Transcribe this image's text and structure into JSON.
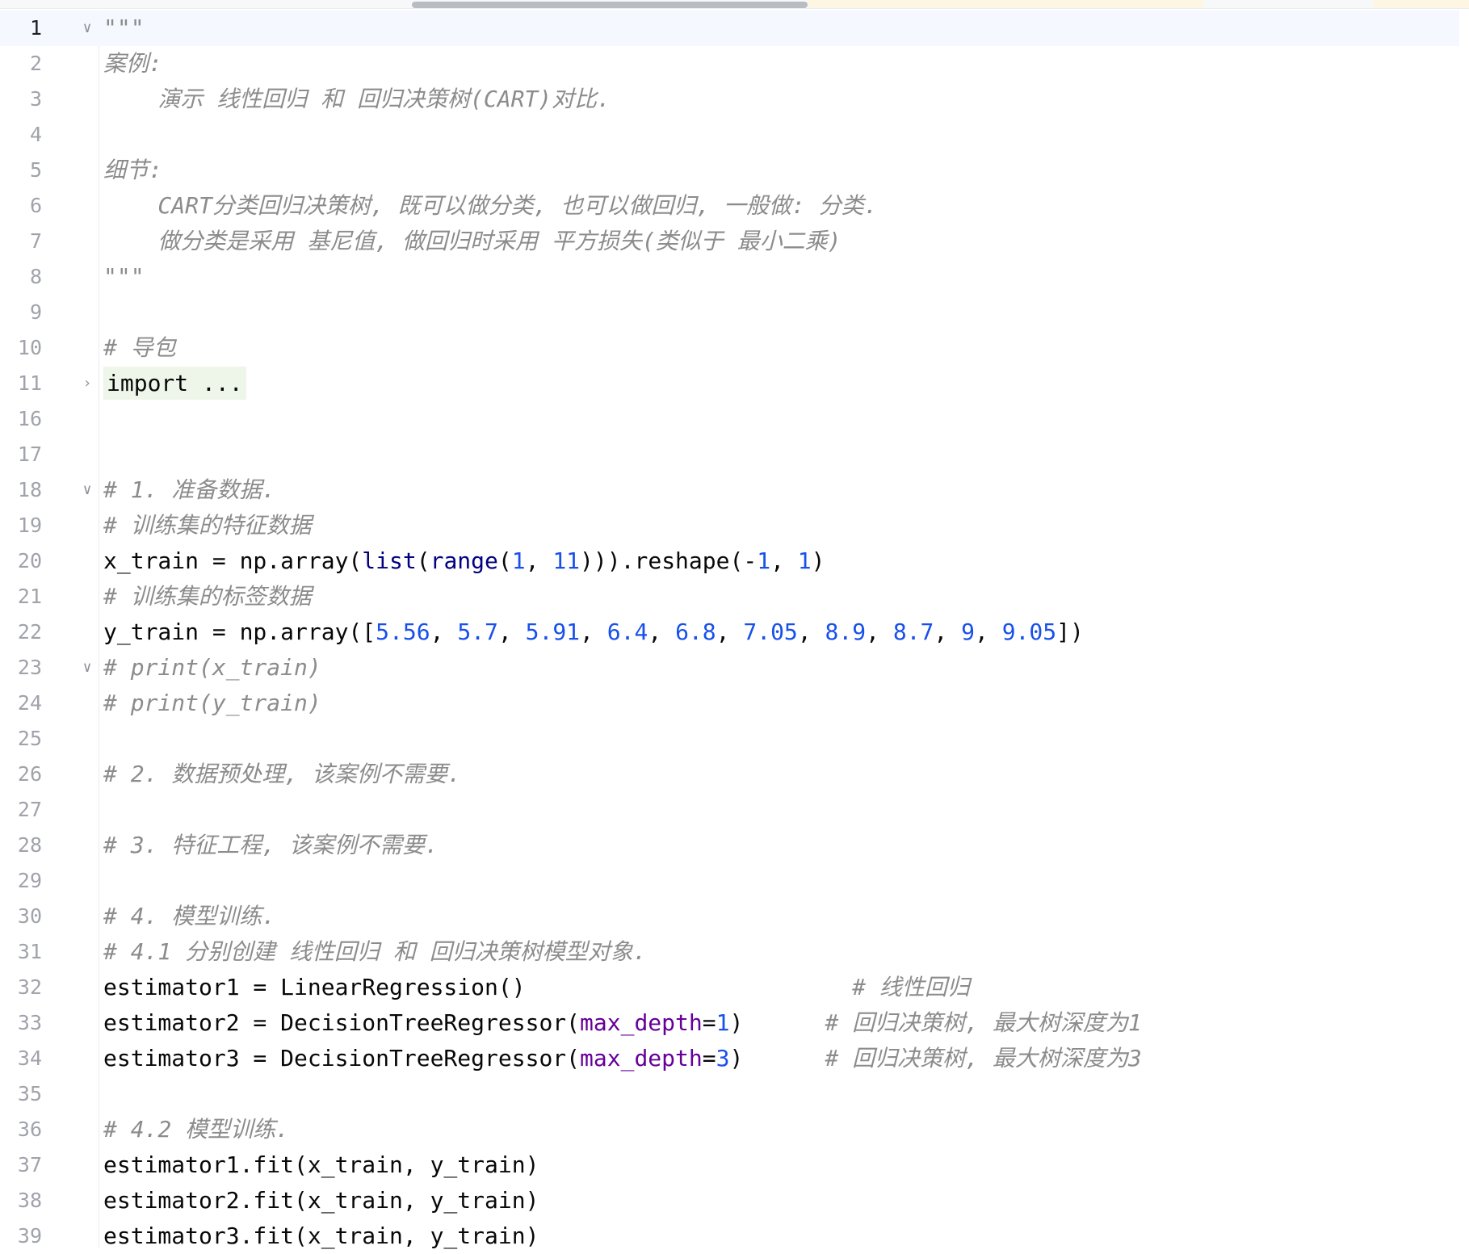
{
  "editor": {
    "colors": {
      "background": "#ffffff",
      "current_line": "#f5f8fe",
      "line_number": "#a1a3ab",
      "comment": "#8c8c8c",
      "number": "#1750eb",
      "keyword_arg": "#660099",
      "fold_highlight": "#edf6e9"
    },
    "lines": [
      {
        "n": "1",
        "fold": "chevron-down",
        "current": true,
        "tokens": [
          {
            "t": "\"\"\"",
            "c": "doc"
          }
        ]
      },
      {
        "n": "2",
        "tokens": [
          {
            "t": "案例:",
            "c": "doc"
          }
        ]
      },
      {
        "n": "3",
        "tokens": [
          {
            "t": "    演示 线性回归 和 回归决策树(CART)对比.",
            "c": "doc"
          }
        ]
      },
      {
        "n": "4",
        "tokens": []
      },
      {
        "n": "5",
        "tokens": [
          {
            "t": "细节:",
            "c": "doc"
          }
        ]
      },
      {
        "n": "6",
        "tokens": [
          {
            "t": "    CART分类回归决策树, 既可以做分类, 也可以做回归, 一般做: 分类.",
            "c": "doc"
          }
        ]
      },
      {
        "n": "7",
        "tokens": [
          {
            "t": "    做分类是采用 基尼值, 做回归时采用 平方损失(类似于 最小二乘)",
            "c": "doc"
          }
        ]
      },
      {
        "n": "8",
        "tokens": [
          {
            "t": "\"\"\"",
            "c": "doc"
          }
        ]
      },
      {
        "n": "9",
        "tokens": []
      },
      {
        "n": "10",
        "tokens": [
          {
            "t": "# 导包",
            "c": "comment"
          }
        ]
      },
      {
        "n": "11",
        "fold": "chevron-right",
        "tokens": [
          {
            "t": "import ...",
            "c": "fold"
          }
        ]
      },
      {
        "n": "16",
        "tokens": []
      },
      {
        "n": "17",
        "tokens": []
      },
      {
        "n": "18",
        "fold": "chevron-down",
        "tokens": [
          {
            "t": "# 1. 准备数据.",
            "c": "comment"
          }
        ]
      },
      {
        "n": "19",
        "tokens": [
          {
            "t": "# 训练集的特征数据",
            "c": "comment"
          }
        ]
      },
      {
        "n": "20",
        "tokens": [
          {
            "t": "x_train = np.array("
          },
          {
            "t": "list",
            "c": "builtin"
          },
          {
            "t": "("
          },
          {
            "t": "range",
            "c": "builtin"
          },
          {
            "t": "("
          },
          {
            "t": "1",
            "c": "num"
          },
          {
            "t": ", "
          },
          {
            "t": "11",
            "c": "num"
          },
          {
            "t": "))).reshape(-"
          },
          {
            "t": "1",
            "c": "num"
          },
          {
            "t": ", "
          },
          {
            "t": "1",
            "c": "num"
          },
          {
            "t": ")"
          }
        ]
      },
      {
        "n": "21",
        "tokens": [
          {
            "t": "# 训练集的标签数据",
            "c": "comment"
          }
        ]
      },
      {
        "n": "22",
        "tokens": [
          {
            "t": "y_train = np.array(["
          },
          {
            "t": "5.56",
            "c": "num"
          },
          {
            "t": ", "
          },
          {
            "t": "5.7",
            "c": "num"
          },
          {
            "t": ", "
          },
          {
            "t": "5.91",
            "c": "num"
          },
          {
            "t": ", "
          },
          {
            "t": "6.4",
            "c": "num"
          },
          {
            "t": ", "
          },
          {
            "t": "6.8",
            "c": "num"
          },
          {
            "t": ", "
          },
          {
            "t": "7.05",
            "c": "num"
          },
          {
            "t": ", "
          },
          {
            "t": "8.9",
            "c": "num"
          },
          {
            "t": ", "
          },
          {
            "t": "8.7",
            "c": "num"
          },
          {
            "t": ", "
          },
          {
            "t": "9",
            "c": "num"
          },
          {
            "t": ", "
          },
          {
            "t": "9.05",
            "c": "num"
          },
          {
            "t": "])"
          }
        ]
      },
      {
        "n": "23",
        "fold": "chevron-down",
        "tokens": [
          {
            "t": "# print(x_train)",
            "c": "comment"
          }
        ]
      },
      {
        "n": "24",
        "tokens": [
          {
            "t": "# print(y_train)",
            "c": "comment"
          }
        ]
      },
      {
        "n": "25",
        "tokens": []
      },
      {
        "n": "26",
        "tokens": [
          {
            "t": "# 2. 数据预处理, 该案例不需要.",
            "c": "comment"
          }
        ]
      },
      {
        "n": "27",
        "tokens": []
      },
      {
        "n": "28",
        "tokens": [
          {
            "t": "# 3. 特征工程, 该案例不需要.",
            "c": "comment"
          }
        ]
      },
      {
        "n": "29",
        "tokens": []
      },
      {
        "n": "30",
        "tokens": [
          {
            "t": "# 4. 模型训练.",
            "c": "comment"
          }
        ]
      },
      {
        "n": "31",
        "tokens": [
          {
            "t": "# 4.1 分别创建 线性回归 和 回归决策树模型对象.",
            "c": "comment"
          }
        ]
      },
      {
        "n": "32",
        "tokens": [
          {
            "t": "estimator1 = LinearRegression()                        "
          },
          {
            "t": "# 线性回归",
            "c": "comment"
          }
        ]
      },
      {
        "n": "33",
        "tokens": [
          {
            "t": "estimator2 = DecisionTreeRegressor("
          },
          {
            "t": "max_depth",
            "c": "param"
          },
          {
            "t": "="
          },
          {
            "t": "1",
            "c": "num"
          },
          {
            "t": ")      "
          },
          {
            "t": "# 回归决策树, 最大树深度为1",
            "c": "comment"
          }
        ]
      },
      {
        "n": "34",
        "tokens": [
          {
            "t": "estimator3 = DecisionTreeRegressor("
          },
          {
            "t": "max_depth",
            "c": "param"
          },
          {
            "t": "="
          },
          {
            "t": "3",
            "c": "num"
          },
          {
            "t": ")      "
          },
          {
            "t": "# 回归决策树, 最大树深度为3",
            "c": "comment"
          }
        ]
      },
      {
        "n": "35",
        "tokens": []
      },
      {
        "n": "36",
        "tokens": [
          {
            "t": "# 4.2 模型训练.",
            "c": "comment"
          }
        ]
      },
      {
        "n": "37",
        "tokens": [
          {
            "t": "estimator1.fit(x_train, y_train)"
          }
        ]
      },
      {
        "n": "38",
        "tokens": [
          {
            "t": "estimator2.fit(x_train, y_train)"
          }
        ]
      },
      {
        "n": "39",
        "tokens": [
          {
            "t": "estimator3.fit(x_train, y_train)"
          }
        ]
      }
    ]
  }
}
